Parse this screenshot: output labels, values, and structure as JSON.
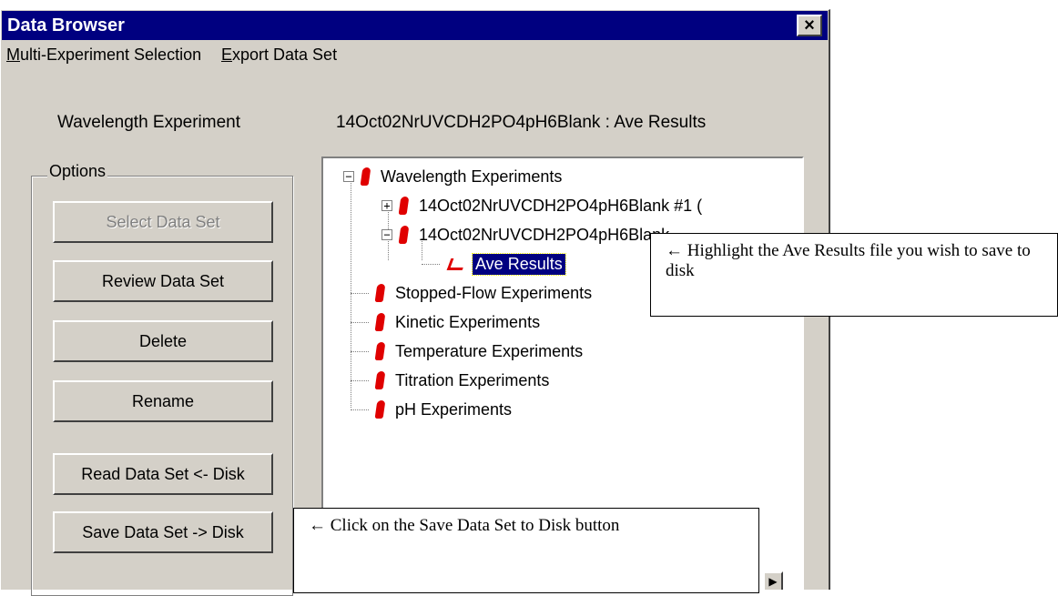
{
  "window": {
    "title": "Data Browser",
    "close_glyph": "×"
  },
  "menu": {
    "item1_ul": "M",
    "item1_rest": "ulti-Experiment Selection",
    "item2_ul": "E",
    "item2_rest": "xport Data Set"
  },
  "header": {
    "experiment_type": "Wavelength Experiment",
    "current_path": "14Oct02NrUVCDH2PO4pH6Blank : Ave Results"
  },
  "options": {
    "legend": "Options",
    "buttons": [
      {
        "label": "Select Data Set",
        "enabled": false
      },
      {
        "label": "Review Data Set",
        "enabled": true
      },
      {
        "label": "Delete",
        "enabled": true
      },
      {
        "label": "Rename",
        "enabled": true
      },
      {
        "label": "Read Data Set <- Disk",
        "enabled": true
      },
      {
        "label": "Save Data Set -> Disk",
        "enabled": true
      }
    ]
  },
  "tree": {
    "root_expander": "−",
    "root": "Wavelength Experiments",
    "child1_expander": "+",
    "child1": "14Oct02NrUVCDH2PO4pH6Blank #1 (",
    "child2_expander": "−",
    "child2": "14Oct02NrUVCDH2PO4pH6Blank",
    "selected": "Ave Results",
    "others": [
      "Stopped-Flow Experiments",
      "Kinetic Experiments",
      "Temperature Experiments",
      "Titration Experiments",
      "pH Experiments"
    ]
  },
  "callouts": {
    "highlight": "← Highlight the Ave Results file you wish to save to disk",
    "save": "← Click on the Save Data Set to Disk button"
  },
  "colors": {
    "titlebar": "#000080",
    "flask": "#e00000",
    "face": "#d4d0c8"
  }
}
